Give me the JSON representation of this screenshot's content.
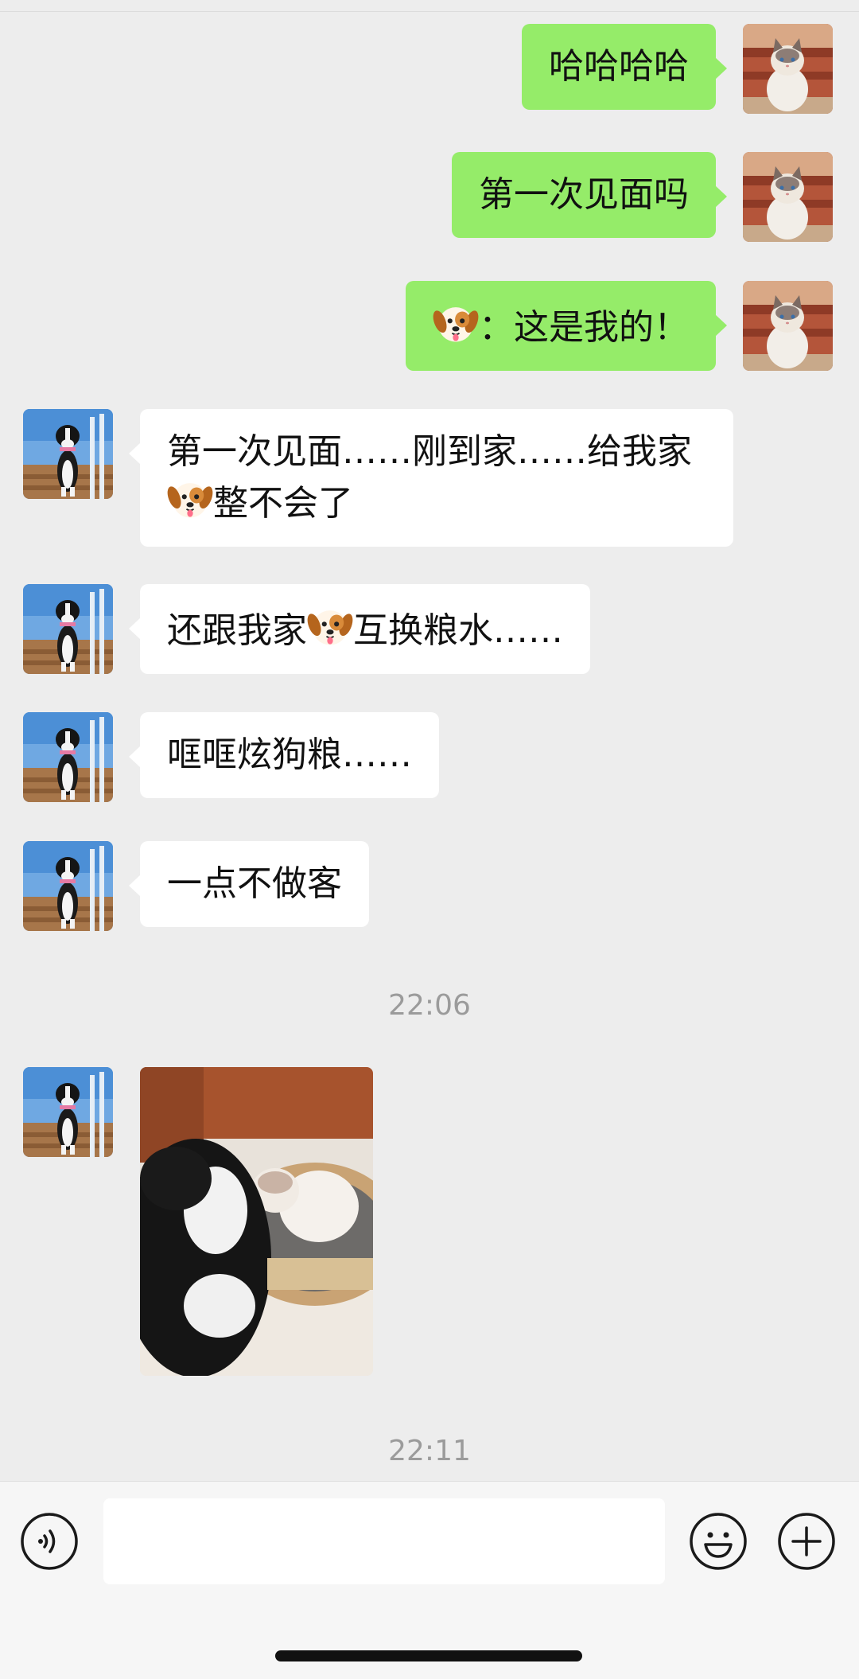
{
  "messages": [
    {
      "side": "right",
      "text": "哈哈哈哈"
    },
    {
      "side": "right",
      "text": "第一次见面吗"
    },
    {
      "side": "right",
      "text_after_emoji": "：这是我的！",
      "emoji": "dog-face-emoji"
    },
    {
      "side": "left",
      "line1": "第一次见面……刚到家……给我家",
      "line2_after_emoji": "整不会了",
      "emoji": "dog-face-emoji"
    },
    {
      "side": "left",
      "text_before_emoji": "还跟我家",
      "text_after_emoji": "互换粮水……",
      "emoji": "dog-face-emoji"
    },
    {
      "side": "left",
      "text": "哐哐炫狗粮……"
    },
    {
      "side": "left",
      "text": "一点不做客"
    },
    {
      "side": "left",
      "type": "image",
      "image": "photo-dog-and-cat-in-basket"
    }
  ],
  "timestamps": [
    "22:06",
    "22:11"
  ],
  "input_bar": {
    "text_value": "",
    "icons": [
      "voice-icon",
      "emoji-icon",
      "plus-icon"
    ]
  },
  "colors": {
    "background": "#ededed",
    "sent_bubble": "#95ec69",
    "received_bubble": "#ffffff",
    "timestamp": "#9b9b9b"
  }
}
